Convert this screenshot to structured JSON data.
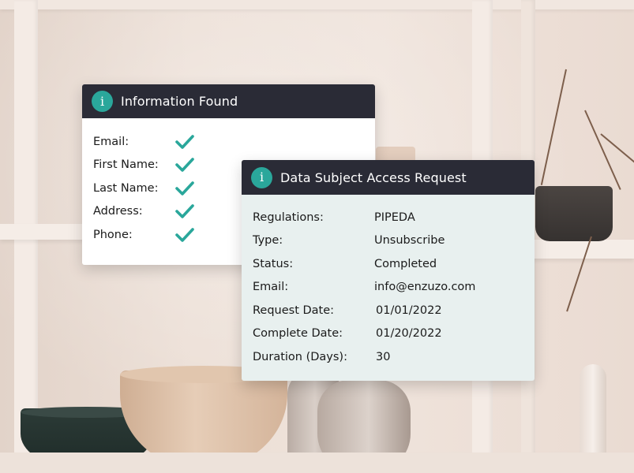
{
  "info_found": {
    "title": "Information Found",
    "icon": "info-icon",
    "icon_glyph": "i",
    "accent": "#2aa79b",
    "header_bg": "#2a2b36",
    "items": [
      {
        "label": "Email:",
        "found": true
      },
      {
        "label": "First Name:",
        "found": true
      },
      {
        "label": "Last Name:",
        "found": true
      },
      {
        "label": "Address:",
        "found": true
      },
      {
        "label": "Phone:",
        "found": true
      }
    ]
  },
  "dsar": {
    "title": "Data Subject Access Request",
    "icon": "info-icon",
    "icon_glyph": "i",
    "fields": [
      {
        "label": "Regulations:",
        "value": "PIPEDA"
      },
      {
        "label": "Type:",
        "value": "Unsubscribe"
      },
      {
        "label": "Status:",
        "value": "Completed"
      },
      {
        "label": "Email:",
        "value": "info@enzuzo.com"
      },
      {
        "label": "Request Date:",
        "value": "01/01/2022"
      },
      {
        "label": "Complete Date:",
        "value": "01/20/2022"
      },
      {
        "label": "Duration (Days):",
        "value": "30"
      }
    ]
  }
}
